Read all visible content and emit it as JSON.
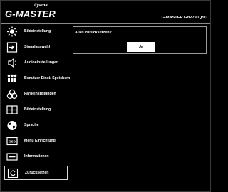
{
  "header": {
    "logo": "G-MASTER",
    "brand": "iiyama",
    "model": "G-MASTER GB2790QSU"
  },
  "menu": {
    "items": [
      {
        "label": "Bildeinstellung",
        "icon": "brightness-icon"
      },
      {
        "label": "Signalauswahl",
        "icon": "input-icon"
      },
      {
        "label": "Audioeinstellungen",
        "icon": "speaker-icon"
      },
      {
        "label": "Benutzer Einst. Speichern",
        "icon": "user-settings-icon"
      },
      {
        "label": "Farbeinstellungen",
        "icon": "color-icon"
      },
      {
        "label": "Bildeinstellung",
        "icon": "image-adjust-icon"
      },
      {
        "label": "Sprache",
        "icon": "globe-icon"
      },
      {
        "label": "Menü Einrichtung",
        "icon": "osd-icon"
      },
      {
        "label": "Informationen",
        "icon": "info-icon"
      },
      {
        "label": "Zurücksetzen",
        "icon": "reset-icon"
      }
    ],
    "selected_index": 9
  },
  "dialog": {
    "question": "Alles zurücksetzen?",
    "confirm_label": "Ja"
  },
  "colors": {
    "background": "#000000",
    "text": "#ffffff",
    "border": "#8a8a8a",
    "button_bg": "#ffffff",
    "button_text": "#000000"
  }
}
